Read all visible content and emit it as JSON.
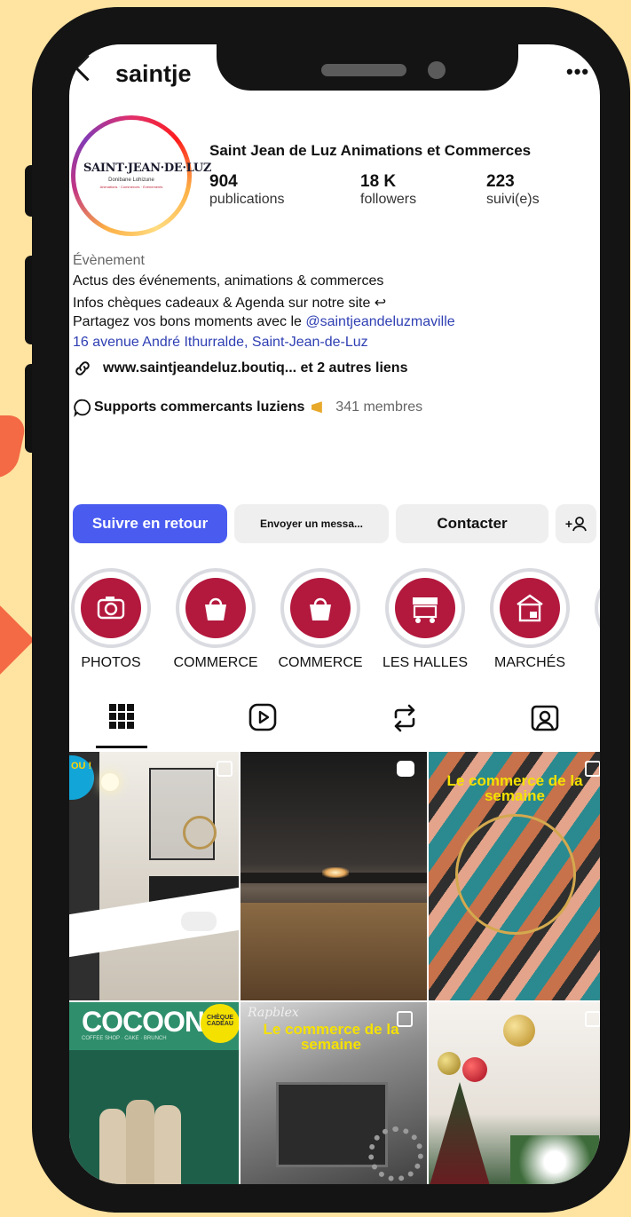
{
  "header": {
    "username": "saintje",
    "more": "•••"
  },
  "profile": {
    "logo_title": "SAINT·JEAN·DE·LUZ",
    "logo_sub": "Donibane Lohizune",
    "logo_tag": "Animations · Commerces · Evénements",
    "display_name": "Saint Jean de Luz Animations et Commerces",
    "stats": [
      {
        "value": "904",
        "label": "publications"
      },
      {
        "value": "18 K",
        "label": "followers"
      },
      {
        "value": "223",
        "label": "suivi(e)s"
      }
    ],
    "category": "Évènement",
    "bio1": "Actus des événements, animations & commerces",
    "bio2": "Infos chèques cadeaux & Agenda sur notre site ↩",
    "bio3_prefix": "Partagez vos bons moments avec le ",
    "bio3_mention": "@saintjeandeluzmaville",
    "address": "16 avenue André Ithurralde, Saint-Jean-de-Luz",
    "link": "www.saintjeandeluz.boutiq... et 2 autres liens",
    "channel_name": "Supports commercants luziens",
    "channel_members": "341 membres"
  },
  "actions": {
    "follow": "Suivre en retour",
    "message": "Envoyer un messa...",
    "contact": "Contacter",
    "add": "+"
  },
  "highlights": [
    "PHOTOS",
    "COMMERCE",
    "COMMERCE",
    "LES HALLES",
    "MARCHÉS"
  ],
  "grid": {
    "cocoon_title": "COCOON",
    "cocoon_sub": "COFFEE SHOP · CAKE · BRUNCH",
    "cocoon_badge": "CHÈQUE CADEAU",
    "promo1": "Le commerce de la semaine",
    "promo2": "Le commerce de la semaine",
    "promo2_brand": "Rapblex",
    "tile1_badge": "OU !"
  },
  "colors": {
    "accent": "#4a5cf0",
    "highlight": "#b3183d",
    "link": "#2f3fb3"
  }
}
